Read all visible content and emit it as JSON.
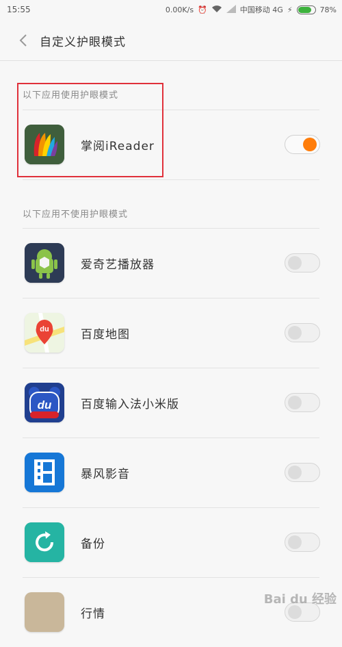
{
  "status_bar": {
    "time": "15:55",
    "network_speed": "0.00K/s",
    "carrier": "中国移动 4G",
    "battery": "78%",
    "battery_level": 0.78
  },
  "header": {
    "title": "自定义护眼模式"
  },
  "sections": {
    "enabled_label": "以下应用使用护眼模式",
    "disabled_label": "以下应用不使用护眼模式"
  },
  "enabled_apps": [
    {
      "name": "掌阅iReader",
      "toggle": "on"
    }
  ],
  "disabled_apps": [
    {
      "name": "爱奇艺播放器",
      "toggle": "off"
    },
    {
      "name": "百度地图",
      "toggle": "off"
    },
    {
      "name": "百度输入法小米版",
      "toggle": "off"
    },
    {
      "name": "暴风影音",
      "toggle": "off"
    },
    {
      "name": "备份",
      "toggle": "off"
    },
    {
      "name": "行情",
      "toggle": "off"
    }
  ],
  "watermark": "Bai du 经验",
  "colors": {
    "toggle_on": "#ff7d0a",
    "highlight_box": "#e0303a"
  }
}
